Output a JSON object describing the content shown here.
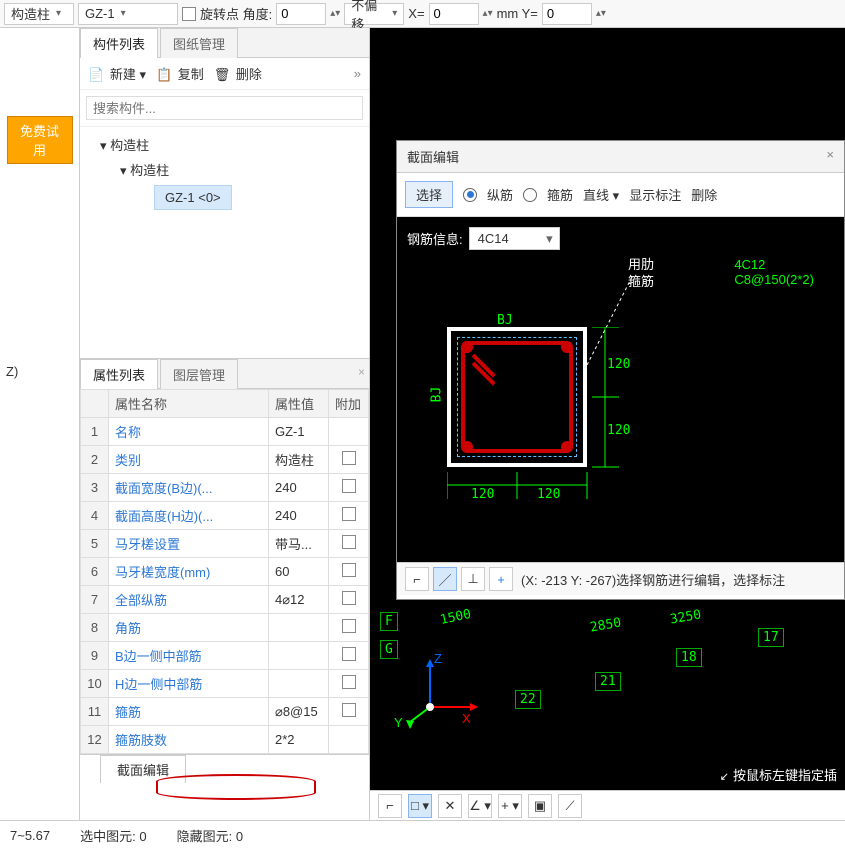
{
  "toolbar": {
    "dd1": "构造柱",
    "dd2": "GZ-1",
    "rot_label": "旋转点 角度:",
    "rot_val": "0",
    "offset": "不偏移",
    "x_label": "X=",
    "x_val": "0",
    "mm_label": "mm Y=",
    "y_val": "0"
  },
  "trial_btn": "免费试用",
  "z_label": "Z)",
  "mid": {
    "tabs": {
      "list": "构件列表",
      "dwg": "图纸管理"
    },
    "tools": {
      "new": "新建",
      "copy": "复制",
      "del": "删除"
    },
    "search_ph": "搜索构件...",
    "tree": {
      "n1": "构造柱",
      "n2": "构造柱",
      "n3": "GZ-1  <0>"
    }
  },
  "prop": {
    "tabs": {
      "list": "属性列表",
      "layer": "图层管理"
    },
    "headers": {
      "name": "属性名称",
      "val": "属性值",
      "extra": "附加"
    },
    "rows": [
      {
        "i": "1",
        "name": "名称",
        "val": "GZ-1",
        "chk": false,
        "link": true
      },
      {
        "i": "2",
        "name": "类别",
        "val": "构造柱",
        "chk": true,
        "link": true
      },
      {
        "i": "3",
        "name": "截面宽度(B边)(...",
        "val": "240",
        "chk": true,
        "link": true
      },
      {
        "i": "4",
        "name": "截面高度(H边)(...",
        "val": "240",
        "chk": true,
        "link": true
      },
      {
        "i": "5",
        "name": "马牙槎设置",
        "val": "带马...",
        "chk": true,
        "link": true
      },
      {
        "i": "6",
        "name": "马牙槎宽度(mm)",
        "val": "60",
        "chk": true,
        "link": true
      },
      {
        "i": "7",
        "name": "全部纵筋",
        "val": "4⌀12",
        "chk": true,
        "link": true
      },
      {
        "i": "8",
        "name": "角筋",
        "val": "",
        "chk": true,
        "link": true
      },
      {
        "i": "9",
        "name": "B边一侧中部筋",
        "val": "",
        "chk": true,
        "link": true
      },
      {
        "i": "10",
        "name": "H边一侧中部筋",
        "val": "",
        "chk": true,
        "link": true
      },
      {
        "i": "11",
        "name": "箍筋",
        "val": "⌀8@15",
        "chk": true,
        "link": true
      },
      {
        "i": "12",
        "name": "箍筋肢数",
        "val": "2*2",
        "chk": false,
        "link": true
      }
    ],
    "bottom_tab": "截面编辑"
  },
  "status": {
    "range": "7~5.67",
    "selected_l": "选中图元:",
    "selected_v": "0",
    "hidden_l": "隐藏图元:",
    "hidden_v": "0"
  },
  "dialog": {
    "title": "截面编辑",
    "close": "×",
    "select": "选择",
    "radio1": "纵筋",
    "radio2": "箍筋",
    "line": "直线",
    "show_dim": "显示标注",
    "del": "删除",
    "rebar_label": "钢筋信息:",
    "rebar_val": "4C14",
    "annot": {
      "head": "用肋",
      "sub": "箍筋",
      "t1": "4C12",
      "t2": "C8@150(2*2)"
    },
    "dims": {
      "d120": "120",
      "bj": "BJ"
    },
    "status_text": "(X: -213 Y: -267)选择钢筋进行编辑，选择标注"
  },
  "bg": {
    "dims": [
      "1500",
      "2850",
      "3250"
    ],
    "nodes": [
      "22",
      "21",
      "18",
      "17"
    ],
    "axes": [
      "F",
      "G"
    ],
    "xyz": {
      "x": "X",
      "y": "Y",
      "z": "Z"
    }
  },
  "hint": "按鼠标左键指定插",
  "chart_data": null
}
